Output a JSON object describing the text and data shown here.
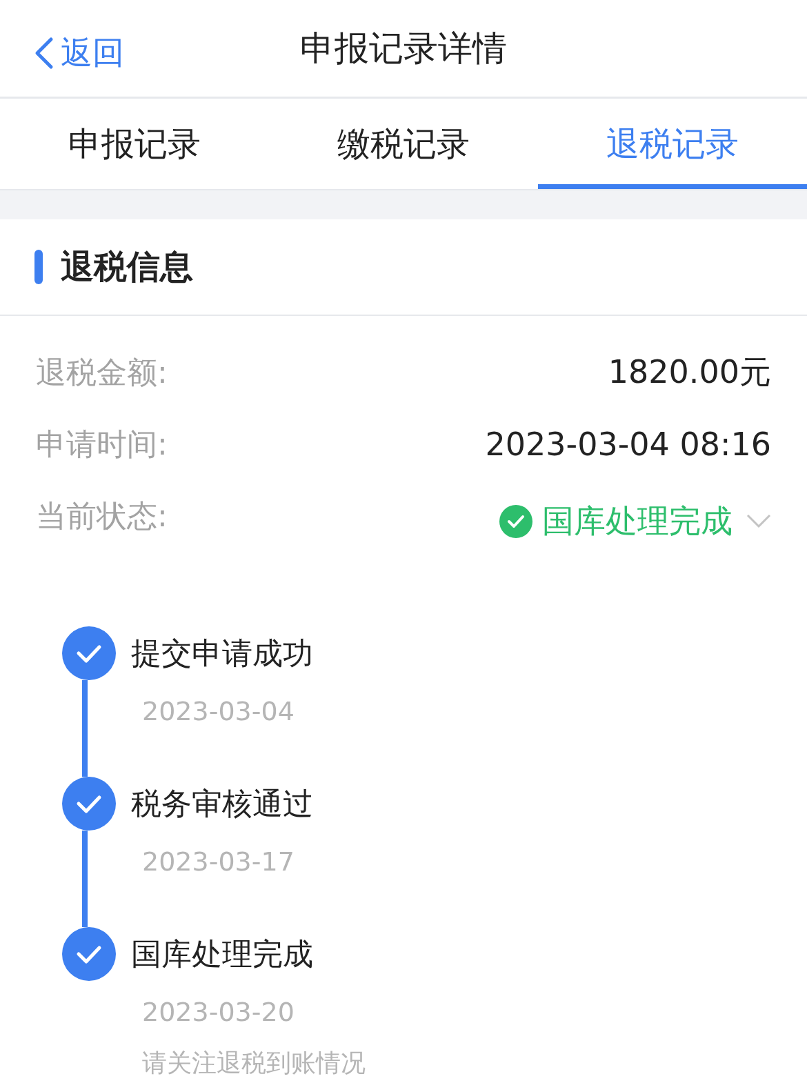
{
  "header": {
    "back": "返回",
    "title": "申报记录详情"
  },
  "tabs": [
    {
      "label": "申报记录",
      "selected": false
    },
    {
      "label": "缴税记录",
      "selected": false
    },
    {
      "label": "退税记录",
      "selected": true
    }
  ],
  "section": {
    "title": "退税信息"
  },
  "fields": [
    {
      "label": "退税金额:",
      "value": "1820.00元",
      "kind": "text"
    },
    {
      "label": "申请时间:",
      "value": "2023-03-04 08:16",
      "kind": "text"
    },
    {
      "label": "当前状态:",
      "value": "国库处理完成",
      "kind": "status",
      "expanded": false
    }
  ],
  "timeline": [
    {
      "title": "提交申请成功",
      "date": "2023-03-04",
      "done": true
    },
    {
      "title": "税务审核通过",
      "date": "2023-03-17",
      "done": true
    },
    {
      "title": "国库处理完成",
      "date": "2023-03-20",
      "done": true,
      "note": "请关注退税到账情况"
    }
  ]
}
